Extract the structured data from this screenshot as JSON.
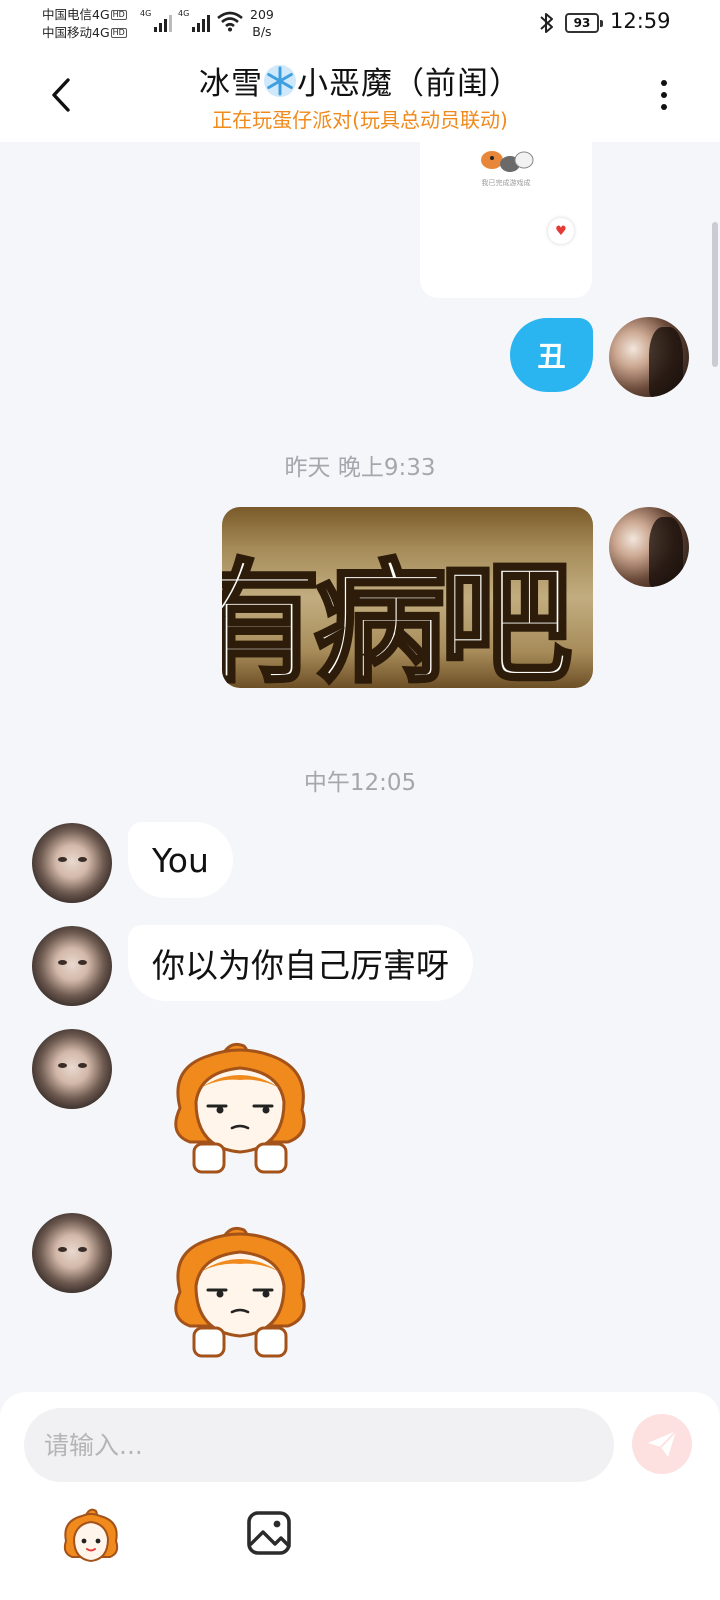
{
  "status_bar": {
    "carrier_1": "中国电信4G",
    "carrier_2": "中国移动4G",
    "hd_badge": "HD",
    "network_type": "4G",
    "net_speed_value": "209",
    "net_speed_unit": "B/s",
    "battery": "93",
    "time": "12:59"
  },
  "header": {
    "title_part1": "冰雪",
    "title_part2": "小恶魔（前闺）",
    "subtitle": "正在玩蛋仔派对(玩具总动员联动)"
  },
  "messages": {
    "card_caption": "我已完成游戏成",
    "bubble_me_1": "丑",
    "timestamp_1": "昨天 晚上9:33",
    "sticker_text": "有病吧",
    "timestamp_2": "中午12:05",
    "bubble_her_1": "You",
    "bubble_her_2": "你以为你自己厉害呀"
  },
  "input_bar": {
    "placeholder": "请输入..."
  },
  "colors": {
    "accent_blue": "#2ab4f0",
    "subtitle_orange": "#f08a1c",
    "send_pink": "#fde0e0"
  },
  "icons": {
    "back": "chevron-left-icon",
    "more": "more-vertical-icon",
    "send": "send-icon",
    "emoji": "eggy-emoji-icon",
    "image": "image-icon",
    "bluetooth": "bluetooth-icon",
    "wifi": "wifi-icon"
  }
}
